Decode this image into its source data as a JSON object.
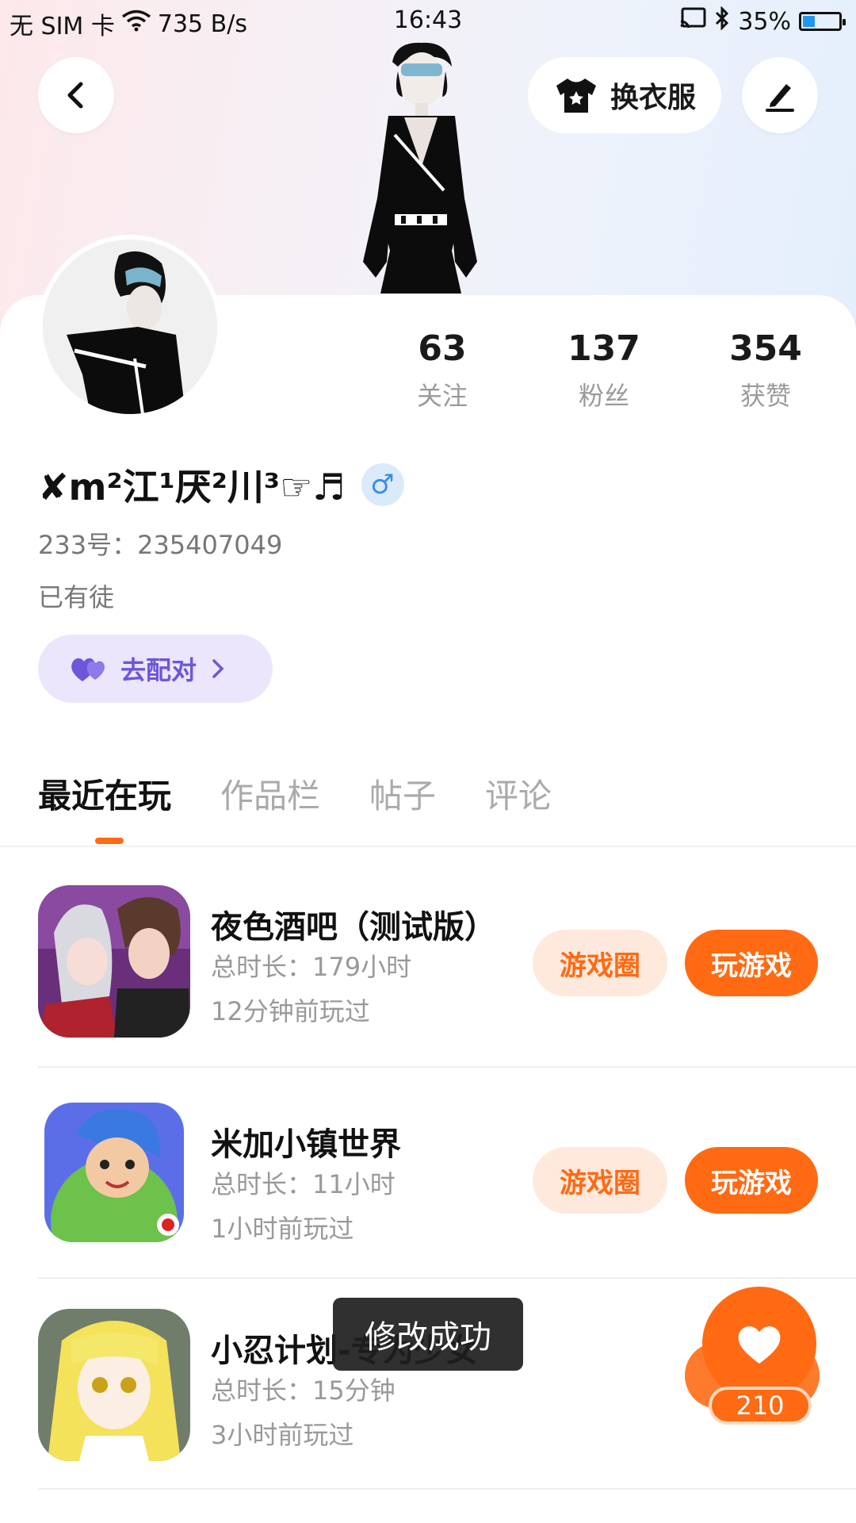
{
  "status_bar": {
    "carrier": "无 SIM 卡",
    "net_speed": "735 B/s",
    "time": "16:43",
    "battery_percent": "35%",
    "battery_level": 0.35
  },
  "header": {
    "outfit_button_label": "换衣服"
  },
  "profile": {
    "stats": [
      {
        "value": "63",
        "label": "关注"
      },
      {
        "value": "137",
        "label": "粉丝"
      },
      {
        "value": "354",
        "label": "获赞"
      }
    ],
    "nickname": "✘m²江¹厌²川³☞♬",
    "gender_symbol": "♂",
    "uid": "233号：235407049",
    "bio": "已有徒",
    "pair_button_label": "去配对"
  },
  "tabs": [
    {
      "label": "最近在玩",
      "active": true
    },
    {
      "label": "作品栏",
      "active": false
    },
    {
      "label": "帖子",
      "active": false
    },
    {
      "label": "评论",
      "active": false
    }
  ],
  "games": [
    {
      "title": "夜色酒吧（测试版）",
      "duration": "总时长：179小时",
      "last_played": "12分钟前玩过",
      "circle_label": "游戏圈",
      "play_label": "玩游戏"
    },
    {
      "title": "米加小镇世界",
      "duration": "总时长：11小时",
      "last_played": "1小时前玩过",
      "circle_label": "游戏圈",
      "play_label": "玩游戏"
    },
    {
      "title": "小忍计划-专为少女",
      "duration": "总时长：15分钟",
      "last_played": "3小时前玩过"
    }
  ],
  "toast": "修改成功",
  "like_count": "210",
  "colors": {
    "accent": "#ff6a13",
    "pair_purple": "#6f55d9",
    "gender_blue": "#3a8ee8"
  }
}
